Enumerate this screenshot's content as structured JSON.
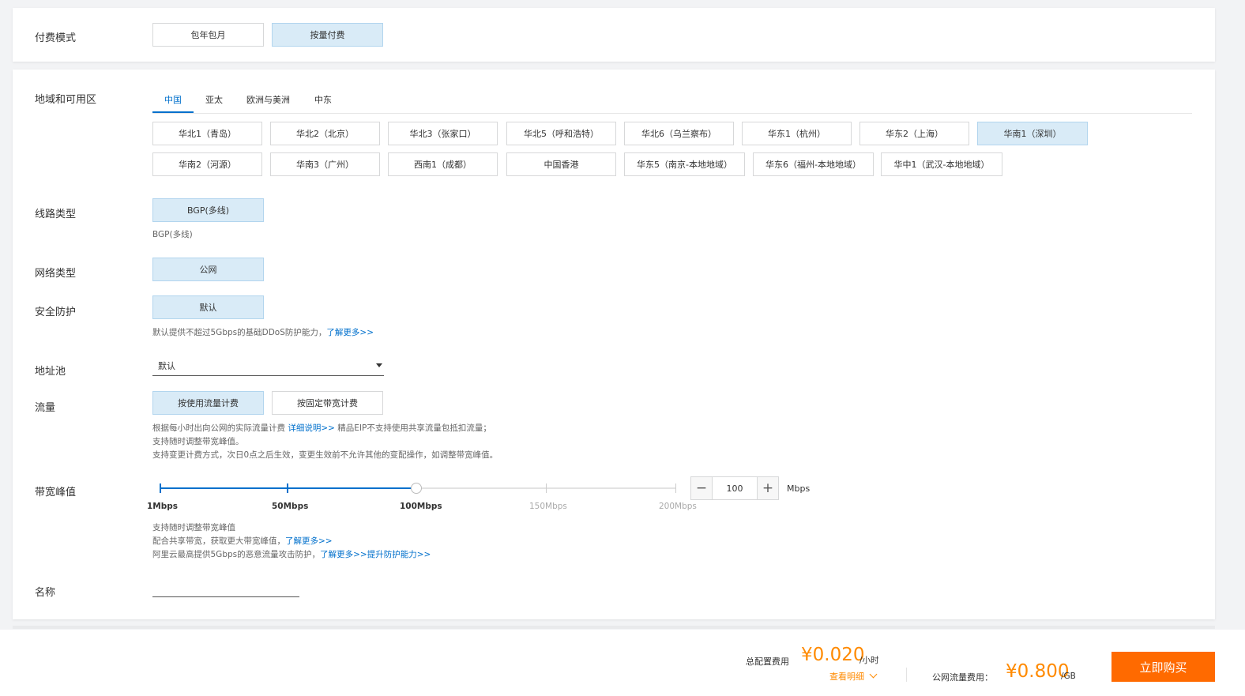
{
  "billing": {
    "label": "付费模式",
    "options": [
      "包年包月",
      "按量付费"
    ],
    "selected": "按量付费"
  },
  "region": {
    "label": "地域和可用区",
    "tabs": [
      "中国",
      "亚太",
      "欧洲与美洲",
      "中东"
    ],
    "active_tab": "中国",
    "regions": [
      "华北1（青岛）",
      "华北2（北京）",
      "华北3（张家口）",
      "华北5（呼和浩特）",
      "华北6（乌兰察布）",
      "华东1（杭州）",
      "华东2（上海）",
      "华南1（深圳）",
      "华南2（河源）",
      "华南3（广州）",
      "西南1（成都）",
      "中国香港",
      "华东5（南京-本地地域）",
      "华东6（福州-本地地域）",
      "华中1（武汉-本地地域）"
    ],
    "selected": "华南1（深圳）"
  },
  "line": {
    "label": "线路类型",
    "option": "BGP(多线)",
    "note": "BGP(多线)"
  },
  "network": {
    "label": "网络类型",
    "option": "公网"
  },
  "security": {
    "label": "安全防护",
    "option": "默认",
    "note": "默认提供不超过5Gbps的基础DDoS防护能力，",
    "link": "了解更多>>"
  },
  "pool": {
    "label": "地址池",
    "value": "默认"
  },
  "traffic": {
    "label": "流量",
    "options": [
      "按使用流量计费",
      "按固定带宽计费"
    ],
    "selected": "按使用流量计费",
    "note1_a": "根据每小时出向公网的实际流量计费 ",
    "note1_link": "详细说明>>",
    "note1_b": " 精品EIP不支持使用共享流量包抵扣流量；",
    "note2": "支持随时调整带宽峰值。",
    "note3": "支持变更计费方式，次日0点之后生效，变更生效前不允许其他的变配操作，如调整带宽峰值。"
  },
  "bandwidth": {
    "label": "带宽峰值",
    "marks": [
      "1Mbps",
      "50Mbps",
      "100Mbps",
      "150Mbps",
      "200Mbps"
    ],
    "value": "100",
    "unit": "Mbps",
    "note1": "支持随时调整带宽峰值",
    "note2": "配合共享带宽，获取更大带宽峰值，",
    "note2_link": "了解更多>>",
    "note3": "阿里云最高提供5Gbps的恶意流量攻击防护，",
    "note3_link": "了解更多>>提升防护能力>>"
  },
  "name": {
    "label": "名称"
  },
  "footer": {
    "total_label": "总配置费用",
    "total_price": "¥0.020",
    "total_unit": "/小时",
    "detail": "查看明细",
    "traffic_label": "公网流量费用：",
    "traffic_price": "¥0.800",
    "traffic_unit": "/GB",
    "buy": "立即购买"
  },
  "colors": {
    "accent": "#0070cc",
    "price": "#ff8a00",
    "buy": "#ff6a00",
    "selected_bg": "#d9ebf7"
  }
}
